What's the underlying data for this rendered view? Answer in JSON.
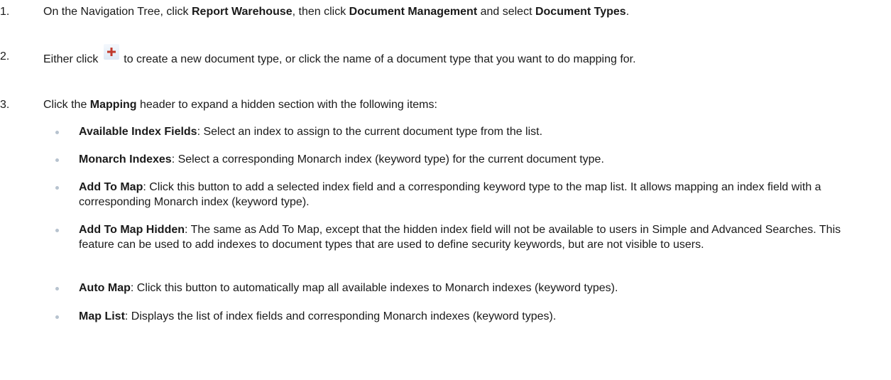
{
  "steps": [
    {
      "num": "1.",
      "a": "On the Navigation Tree, click ",
      "b": "Report Warehouse",
      "c": ", then click ",
      "d": "Document Management",
      "e": " and select ",
      "f": "Document Types",
      "g": "."
    },
    {
      "num": "2.",
      "a": "Either click ",
      "icon": "add-plus-icon",
      "b": " to create a new document type, or click the name of a document type that you want to do mapping for."
    },
    {
      "num": "3.",
      "a": "Click the ",
      "b": "Mapping",
      "c": " header to expand a hidden section with the following items:"
    }
  ],
  "items": [
    {
      "term": "Available Index Fields",
      "desc": ": Select an index to assign to the current document type from the list."
    },
    {
      "term": "Monarch Indexes",
      "desc": ": Select a corresponding Monarch index (keyword type) for the current document type."
    },
    {
      "term": "Add To Map",
      "desc": ": Click this button to add a selected index field and a corresponding keyword type to the map list. It allows mapping an index field with a corresponding Monarch index (keyword type)."
    },
    {
      "term": "Add To Map Hidden",
      "desc": ": The same as Add To Map, except that the hidden index field will not be available to users in Simple and Advanced Searches. This feature can be used to add indexes to document types that are used to define security keywords, but are not visible to users."
    },
    {
      "term": "Auto Map",
      "desc": ": Click this button to automatically map all available indexes to Monarch indexes (keyword types)."
    },
    {
      "term": "Map List",
      "desc": ": Displays the list of index fields and corresponding Monarch indexes (keyword types)."
    }
  ],
  "colors": {
    "text": "#1a1a1a",
    "bullet": "#b7c3cf",
    "icon_plus": "#c0392b"
  }
}
